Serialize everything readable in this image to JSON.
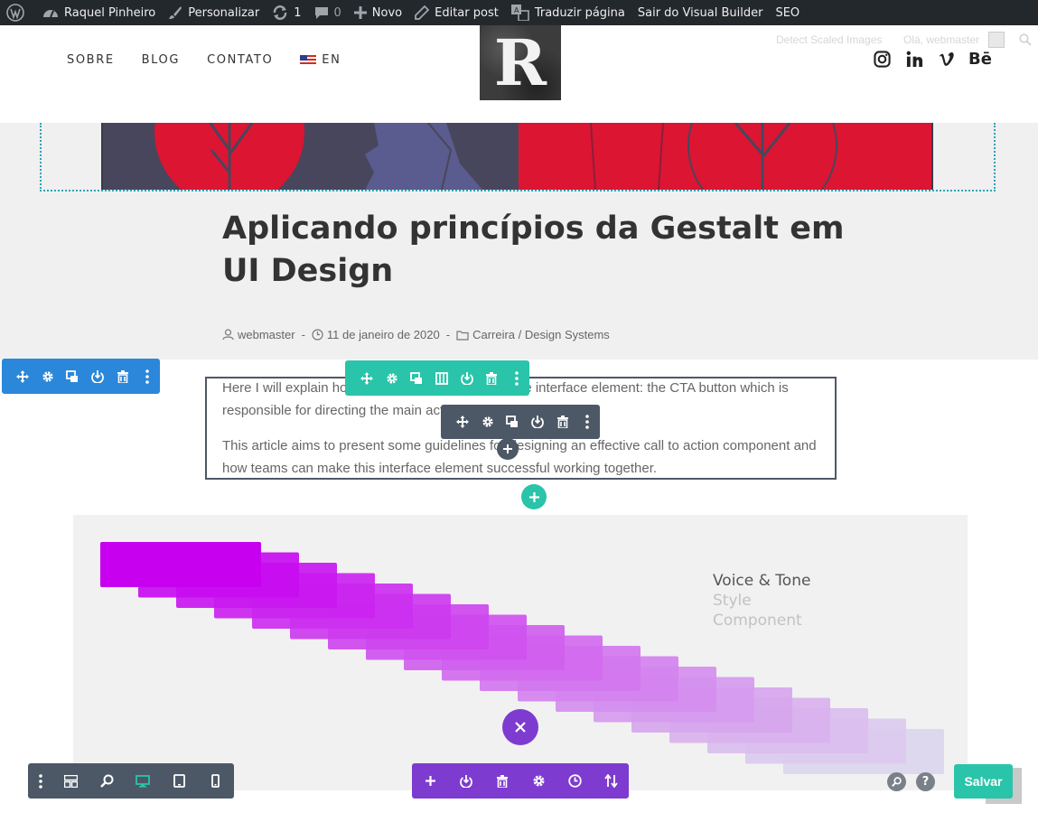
{
  "admin_bar": {
    "site_name": "Raquel Pinheiro",
    "customize": "Personalizar",
    "updates_count": "1",
    "comments_count": "0",
    "new": "Novo",
    "edit_post": "Editar post",
    "translate": "Traduzir página",
    "exit_builder": "Sair do Visual Builder",
    "seo": "SEO"
  },
  "header": {
    "nav": [
      "SOBRE",
      "BLOG",
      "CONTATO"
    ],
    "lang": "EN",
    "logo_letter": "R",
    "detect_scaled": "Detect Scaled Images",
    "greeting": "Olá, webmaster",
    "social": [
      "instagram-icon",
      "linkedin-icon",
      "vimeo-icon",
      "behance-icon"
    ],
    "behance_text": "Bē"
  },
  "post": {
    "title": "Aplicando princípios da Gestalt em UI Design",
    "author": "webmaster",
    "date": "11 de janeiro de 2020",
    "categories": "Carreira / Design Systems",
    "paragraphs": [
      "Here I will explain how to start by analysing a single interface element: the CTA button which is responsible for directing the main action of your web page.",
      "This article aims to present some guidelines for designing an effective call to action component and how teams can make this interface element successful working together."
    ]
  },
  "illustration": {
    "lines": [
      "Voice & Tone",
      "Style",
      "Component"
    ],
    "colors": {
      "start": "#c700f0",
      "end": "#dcd6ee"
    }
  },
  "builder": {
    "save_label": "Salvar",
    "colors": {
      "section": "#2b87da",
      "row": "#29c4a9",
      "module": "#4c5866",
      "page": "#7e3bd0"
    }
  }
}
